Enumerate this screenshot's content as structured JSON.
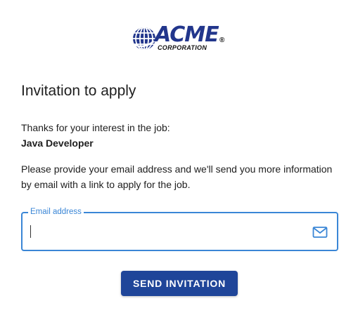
{
  "logo": {
    "name": "ACME",
    "subtitle": "CORPORATION",
    "registered_mark": "®",
    "brand_color": "#22368c"
  },
  "page": {
    "title": "Invitation to apply",
    "intro": "Thanks for your interest in the job:",
    "job_title": "Java Developer",
    "description": "Please provide your email address and we'll send you more information by email with a link to apply for the job."
  },
  "form": {
    "email_label": "Email address",
    "email_value": "",
    "email_placeholder": "",
    "email_icon": "mail-icon",
    "accent_color": "#3a86d6",
    "submit_label": "SEND INVITATION",
    "submit_color": "#1f4599"
  }
}
